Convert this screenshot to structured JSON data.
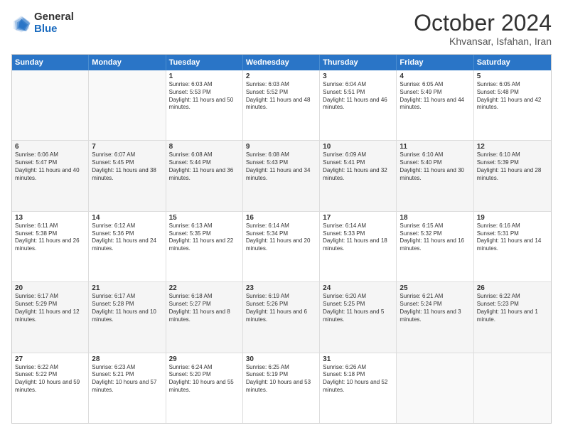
{
  "logo": {
    "general": "General",
    "blue": "Blue"
  },
  "header": {
    "month": "October 2024",
    "location": "Khvansar, Isfahan, Iran"
  },
  "dayHeaders": [
    "Sunday",
    "Monday",
    "Tuesday",
    "Wednesday",
    "Thursday",
    "Friday",
    "Saturday"
  ],
  "weeks": [
    [
      {
        "day": "",
        "info": ""
      },
      {
        "day": "",
        "info": ""
      },
      {
        "day": "1",
        "info": "Sunrise: 6:03 AM\nSunset: 5:53 PM\nDaylight: 11 hours and 50 minutes."
      },
      {
        "day": "2",
        "info": "Sunrise: 6:03 AM\nSunset: 5:52 PM\nDaylight: 11 hours and 48 minutes."
      },
      {
        "day": "3",
        "info": "Sunrise: 6:04 AM\nSunset: 5:51 PM\nDaylight: 11 hours and 46 minutes."
      },
      {
        "day": "4",
        "info": "Sunrise: 6:05 AM\nSunset: 5:49 PM\nDaylight: 11 hours and 44 minutes."
      },
      {
        "day": "5",
        "info": "Sunrise: 6:05 AM\nSunset: 5:48 PM\nDaylight: 11 hours and 42 minutes."
      }
    ],
    [
      {
        "day": "6",
        "info": "Sunrise: 6:06 AM\nSunset: 5:47 PM\nDaylight: 11 hours and 40 minutes."
      },
      {
        "day": "7",
        "info": "Sunrise: 6:07 AM\nSunset: 5:45 PM\nDaylight: 11 hours and 38 minutes."
      },
      {
        "day": "8",
        "info": "Sunrise: 6:08 AM\nSunset: 5:44 PM\nDaylight: 11 hours and 36 minutes."
      },
      {
        "day": "9",
        "info": "Sunrise: 6:08 AM\nSunset: 5:43 PM\nDaylight: 11 hours and 34 minutes."
      },
      {
        "day": "10",
        "info": "Sunrise: 6:09 AM\nSunset: 5:41 PM\nDaylight: 11 hours and 32 minutes."
      },
      {
        "day": "11",
        "info": "Sunrise: 6:10 AM\nSunset: 5:40 PM\nDaylight: 11 hours and 30 minutes."
      },
      {
        "day": "12",
        "info": "Sunrise: 6:10 AM\nSunset: 5:39 PM\nDaylight: 11 hours and 28 minutes."
      }
    ],
    [
      {
        "day": "13",
        "info": "Sunrise: 6:11 AM\nSunset: 5:38 PM\nDaylight: 11 hours and 26 minutes."
      },
      {
        "day": "14",
        "info": "Sunrise: 6:12 AM\nSunset: 5:36 PM\nDaylight: 11 hours and 24 minutes."
      },
      {
        "day": "15",
        "info": "Sunrise: 6:13 AM\nSunset: 5:35 PM\nDaylight: 11 hours and 22 minutes."
      },
      {
        "day": "16",
        "info": "Sunrise: 6:14 AM\nSunset: 5:34 PM\nDaylight: 11 hours and 20 minutes."
      },
      {
        "day": "17",
        "info": "Sunrise: 6:14 AM\nSunset: 5:33 PM\nDaylight: 11 hours and 18 minutes."
      },
      {
        "day": "18",
        "info": "Sunrise: 6:15 AM\nSunset: 5:32 PM\nDaylight: 11 hours and 16 minutes."
      },
      {
        "day": "19",
        "info": "Sunrise: 6:16 AM\nSunset: 5:31 PM\nDaylight: 11 hours and 14 minutes."
      }
    ],
    [
      {
        "day": "20",
        "info": "Sunrise: 6:17 AM\nSunset: 5:29 PM\nDaylight: 11 hours and 12 minutes."
      },
      {
        "day": "21",
        "info": "Sunrise: 6:17 AM\nSunset: 5:28 PM\nDaylight: 11 hours and 10 minutes."
      },
      {
        "day": "22",
        "info": "Sunrise: 6:18 AM\nSunset: 5:27 PM\nDaylight: 11 hours and 8 minutes."
      },
      {
        "day": "23",
        "info": "Sunrise: 6:19 AM\nSunset: 5:26 PM\nDaylight: 11 hours and 6 minutes."
      },
      {
        "day": "24",
        "info": "Sunrise: 6:20 AM\nSunset: 5:25 PM\nDaylight: 11 hours and 5 minutes."
      },
      {
        "day": "25",
        "info": "Sunrise: 6:21 AM\nSunset: 5:24 PM\nDaylight: 11 hours and 3 minutes."
      },
      {
        "day": "26",
        "info": "Sunrise: 6:22 AM\nSunset: 5:23 PM\nDaylight: 11 hours and 1 minute."
      }
    ],
    [
      {
        "day": "27",
        "info": "Sunrise: 6:22 AM\nSunset: 5:22 PM\nDaylight: 10 hours and 59 minutes."
      },
      {
        "day": "28",
        "info": "Sunrise: 6:23 AM\nSunset: 5:21 PM\nDaylight: 10 hours and 57 minutes."
      },
      {
        "day": "29",
        "info": "Sunrise: 6:24 AM\nSunset: 5:20 PM\nDaylight: 10 hours and 55 minutes."
      },
      {
        "day": "30",
        "info": "Sunrise: 6:25 AM\nSunset: 5:19 PM\nDaylight: 10 hours and 53 minutes."
      },
      {
        "day": "31",
        "info": "Sunrise: 6:26 AM\nSunset: 5:18 PM\nDaylight: 10 hours and 52 minutes."
      },
      {
        "day": "",
        "info": ""
      },
      {
        "day": "",
        "info": ""
      }
    ]
  ]
}
